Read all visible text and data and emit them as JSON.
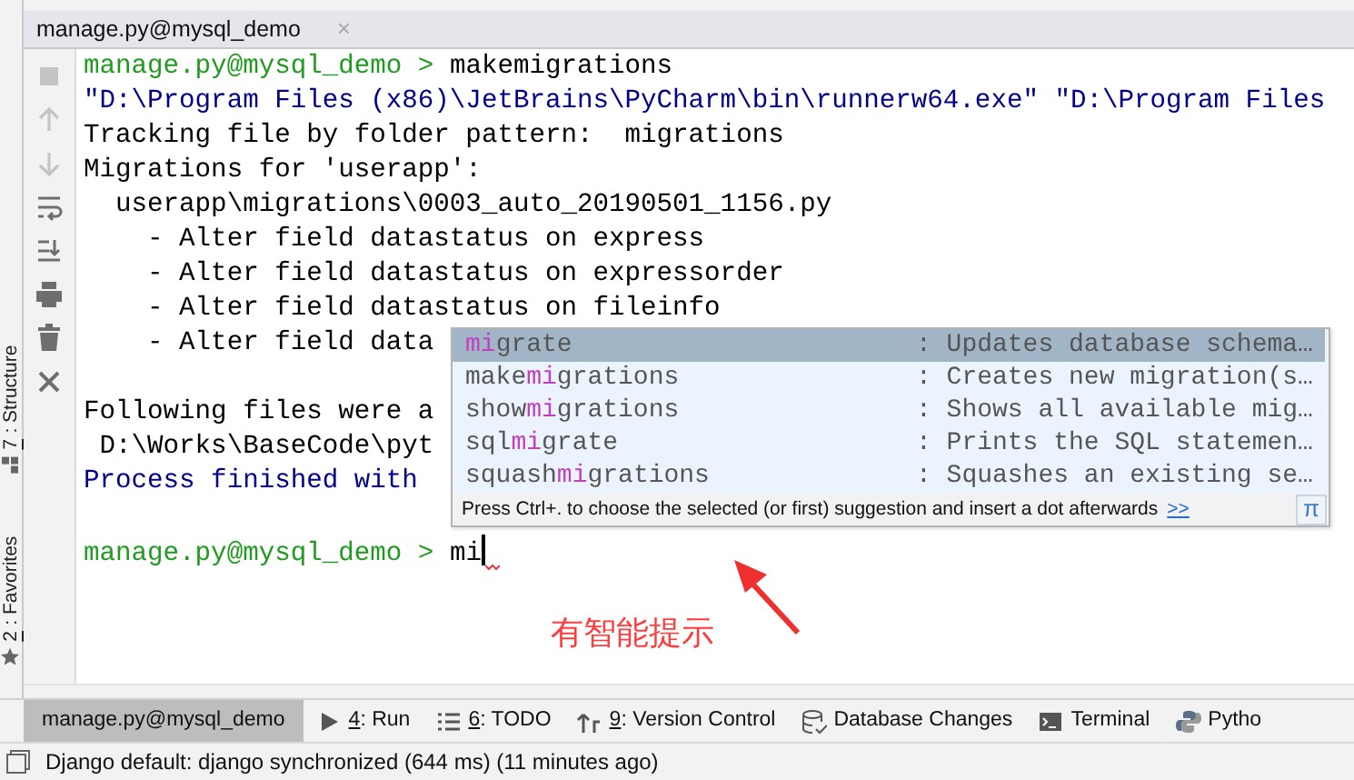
{
  "editor_tab": {
    "title": "manage.py@mysql_demo",
    "close": "×"
  },
  "side_panels": [
    {
      "number": "7",
      "label": ": Structure",
      "kind": "structure"
    },
    {
      "number": "2",
      "label": ": Favorites",
      "kind": "favorites"
    }
  ],
  "console_toolbar": [
    {
      "kind": "stop",
      "disabled": true
    },
    {
      "kind": "up",
      "disabled": true
    },
    {
      "kind": "down",
      "disabled": true
    },
    {
      "kind": "wrap",
      "disabled": false
    },
    {
      "kind": "scroll",
      "disabled": false
    },
    {
      "kind": "print",
      "disabled": false
    },
    {
      "kind": "trash",
      "disabled": false
    },
    {
      "kind": "close",
      "disabled": false
    }
  ],
  "console_lines": [
    {
      "kind": "prompt",
      "prompt": "manage.py@mysql_demo >",
      "command": "makemigrations"
    },
    {
      "kind": "system",
      "text": "\"D:\\Program Files (x86)\\JetBrains\\PyCharm\\bin\\runnerw64.exe\" \"D:\\Program Files"
    },
    {
      "kind": "output",
      "text": "Tracking file by folder pattern:  migrations"
    },
    {
      "kind": "output",
      "text": "Migrations for 'userapp':"
    },
    {
      "kind": "output",
      "text": "  userapp\\migrations\\0003_auto_20190501_1156.py"
    },
    {
      "kind": "output",
      "text": "    - Alter field datastatus on express"
    },
    {
      "kind": "output",
      "text": "    - Alter field datastatus on expressorder"
    },
    {
      "kind": "output",
      "text": "    - Alter field datastatus on fileinfo"
    },
    {
      "kind": "output",
      "text": "    - Alter field data"
    },
    {
      "kind": "blank"
    },
    {
      "kind": "output",
      "text": "Following files were a"
    },
    {
      "kind": "output",
      "text": " D:\\Works\\BaseCode\\pyt"
    },
    {
      "kind": "system",
      "text": "Process finished with "
    },
    {
      "kind": "blank"
    },
    {
      "kind": "prompt",
      "prompt": "manage.py@mysql_demo >",
      "command": "mi"
    }
  ],
  "completion_popup": {
    "items": [
      {
        "match": "mi",
        "suffix": "grate",
        "description": ": Updates database schema…",
        "selected": true
      },
      {
        "prefix": "make",
        "match": "mi",
        "suffix": "grations",
        "description": ": Creates new migration(s…",
        "selected": false
      },
      {
        "prefix": "show",
        "match": "mi",
        "suffix": "grations",
        "description": ": Shows all available mig…",
        "selected": false
      },
      {
        "prefix": "sql",
        "match": "mi",
        "suffix": "grate",
        "description": ": Prints the SQL statemen…",
        "selected": false
      },
      {
        "prefix": "squash",
        "match": "mi",
        "suffix": "grations",
        "description": ": Squashes an existing se…",
        "selected": false
      }
    ],
    "hint": "Press Ctrl+. to choose the selected (or first) suggestion and insert a dot afterwards",
    "hint_link": ">>",
    "pi_button": "π"
  },
  "annotation": {
    "text": "有智能提示"
  },
  "tool_windows": [
    {
      "kind": "console",
      "label": "manage.py@mysql_demo",
      "selected": true
    },
    {
      "kind": "run",
      "number": "4",
      "label": ": Run",
      "selected": false
    },
    {
      "kind": "todo",
      "number": "6",
      "label": ": TODO",
      "selected": false
    },
    {
      "kind": "vcs",
      "number": "9",
      "label": ": Version Control",
      "selected": false
    },
    {
      "kind": "database",
      "label": "Database Changes",
      "selected": false
    },
    {
      "kind": "terminal",
      "label": "Terminal",
      "selected": false
    },
    {
      "kind": "python",
      "label": "Pytho",
      "selected": false
    }
  ],
  "status_bar": {
    "text": "Django default: django synchronized (644 ms) (11 minutes ago)"
  }
}
